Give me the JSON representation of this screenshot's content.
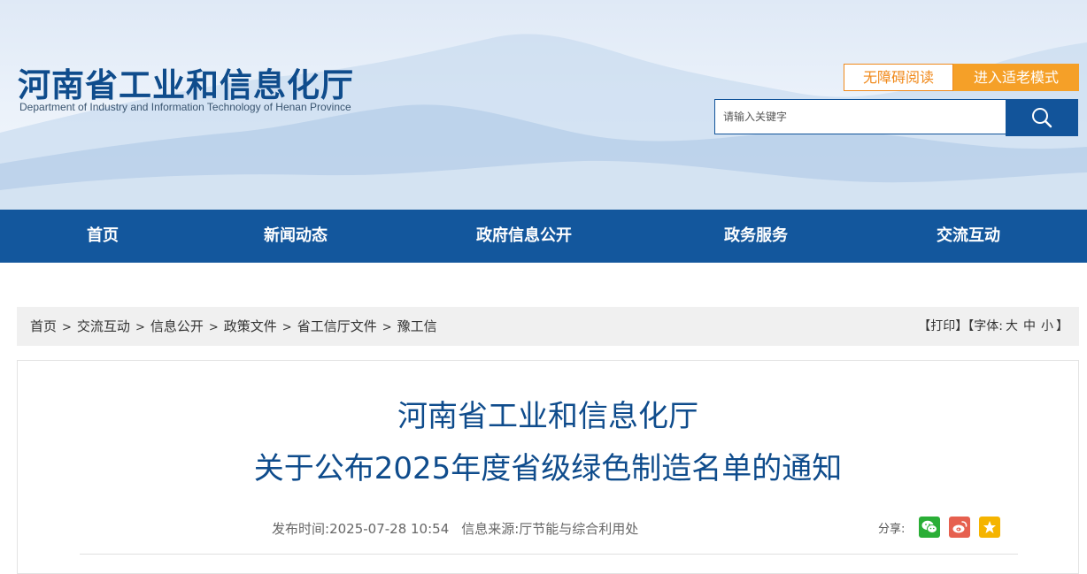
{
  "site": {
    "title_cn": "河南省工业和信息化厅",
    "title_en": "Department of Industry and Information Technology of Henan Province"
  },
  "accessibility": {
    "barrier_free": "无障碍阅读",
    "elder_mode": "进入适老模式"
  },
  "search": {
    "placeholder": "请输入关键字",
    "icon": "search-icon"
  },
  "nav": [
    "首页",
    "新闻动态",
    "政府信息公开",
    "政务服务",
    "交流互动"
  ],
  "breadcrumb": [
    "首页",
    "交流互动",
    "信息公开",
    "政策文件",
    "省工信厅文件",
    "豫工信"
  ],
  "breadcrumb_separator": ">",
  "tools": {
    "print": "【打印】",
    "font_prefix": "【字体:",
    "large": "大",
    "medium": "中",
    "small": "小",
    "font_suffix": "】"
  },
  "article": {
    "title_line1": "河南省工业和信息化厅",
    "title_line2": "关于公布2025年度省级绿色制造名单的通知",
    "publish_label": "发布时间:",
    "publish_time": "2025-07-28 10:54",
    "source_label": "信息来源:",
    "source": "厅节能与综合利用处",
    "share_label": "分享:",
    "share_icons": [
      "wechat-icon",
      "weibo-icon",
      "favorite-icon"
    ]
  },
  "colors": {
    "brand_blue": "#13579d",
    "title_blue": "#0f4c8c",
    "accent_orange": "#f08a1c",
    "wechat_green": "#2aae36",
    "weibo_red": "#e6604f",
    "favorite_yellow": "#f5b400"
  }
}
